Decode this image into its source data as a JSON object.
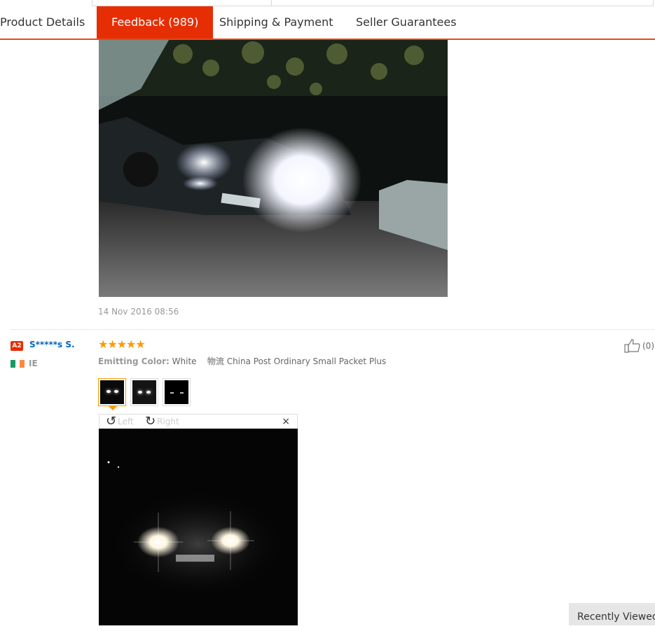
{
  "tabs": [
    {
      "label": "Product Details"
    },
    {
      "label": "Feedback (989)"
    },
    {
      "label": "Shipping & Payment"
    },
    {
      "label": "Seller Guarantees"
    }
  ],
  "review1": {
    "date": "14 Nov 2016 08:56"
  },
  "review2": {
    "level_badge": "A2",
    "username": "S*****s S.",
    "country": "IE",
    "flag_colors": [
      "#169b62",
      "#ffffff",
      "#ff883e"
    ],
    "rating_stars": 5,
    "stars": "★★★★★",
    "emitting_label": "Emitting Color:",
    "emitting_value": "White",
    "logistics_label": "物流",
    "logistics_value": "China Post Ordinary Small Packet Plus",
    "helpful_count": "(0)",
    "thumbnails_count": 3,
    "viewer": {
      "rotate_left": "Left",
      "rotate_right": "Right",
      "close": "×"
    }
  },
  "recently_viewed": "Recently Viewed",
  "colors": {
    "accent": "#e62e04",
    "star": "#ff9900",
    "link": "#0066c0"
  }
}
